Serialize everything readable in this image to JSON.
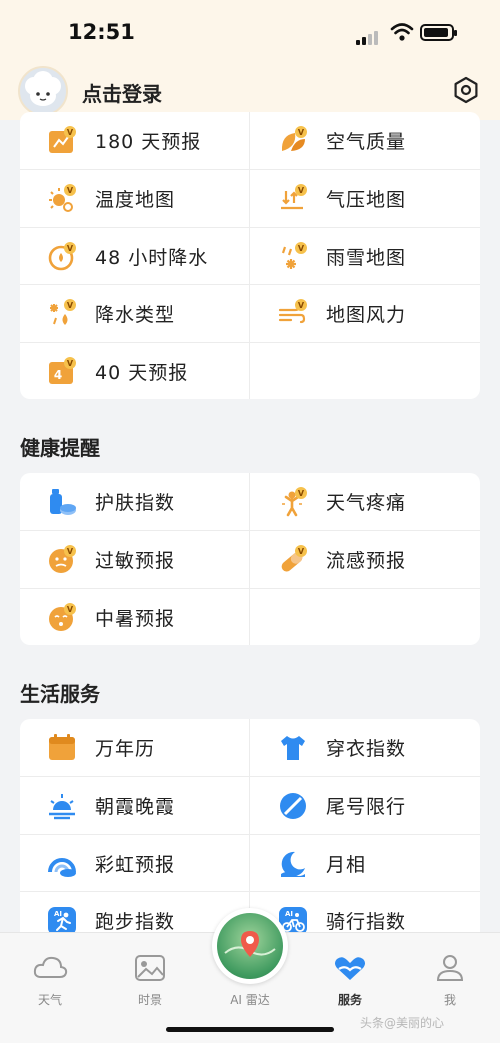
{
  "status": {
    "time": "12:51"
  },
  "header": {
    "login_label": "点击登录"
  },
  "weather_services": [
    {
      "name": "180-day-forecast",
      "label": "180 天预报",
      "icon": "calendar-180-icon"
    },
    {
      "name": "air-quality",
      "label": "空气质量",
      "icon": "leaf-icon"
    },
    {
      "name": "temperature-map",
      "label": "温度地图",
      "icon": "sun-thermometer-icon"
    },
    {
      "name": "pressure-map",
      "label": "气压地图",
      "icon": "pressure-arrows-icon"
    },
    {
      "name": "48h-precipitation",
      "label": "48 小时降水",
      "icon": "clock-rain-icon"
    },
    {
      "name": "rain-snow-map",
      "label": "雨雪地图",
      "icon": "rain-snow-icon"
    },
    {
      "name": "precipitation-type",
      "label": "降水类型",
      "icon": "drops-icon"
    },
    {
      "name": "wind-map",
      "label": "地图风力",
      "icon": "wind-icon"
    },
    {
      "name": "40-day-forecast",
      "label": "40 天预报",
      "icon": "calendar-40-icon"
    }
  ],
  "health": {
    "title": "健康提醒",
    "items": [
      {
        "name": "skin-care-index",
        "label": "护肤指数",
        "icon": "skincare-bottle-icon"
      },
      {
        "name": "weather-pain",
        "label": "天气疼痛",
        "icon": "pain-figure-icon"
      },
      {
        "name": "allergy-forecast",
        "label": "过敏预报",
        "icon": "allergy-face-icon"
      },
      {
        "name": "flu-forecast",
        "label": "流感预报",
        "icon": "pill-icon"
      },
      {
        "name": "heatstroke-forecast",
        "label": "中暑预报",
        "icon": "heatstroke-face-icon"
      }
    ]
  },
  "life": {
    "title": "生活服务",
    "items": [
      {
        "name": "calendar",
        "label": "万年历",
        "icon": "calendar-icon"
      },
      {
        "name": "dressing-index",
        "label": "穿衣指数",
        "icon": "tshirt-icon"
      },
      {
        "name": "sunrise-glow",
        "label": "朝霞晚霞",
        "icon": "sunrise-icon"
      },
      {
        "name": "plate-restriction",
        "label": "尾号限行",
        "icon": "no-entry-icon"
      },
      {
        "name": "rainbow-forecast",
        "label": "彩虹预报",
        "icon": "rainbow-icon"
      },
      {
        "name": "moon-phase",
        "label": "月相",
        "icon": "moon-icon"
      },
      {
        "name": "running-index",
        "label": "跑步指数",
        "icon": "running-icon"
      },
      {
        "name": "cycling-index",
        "label": "骑行指数",
        "icon": "cycling-icon"
      }
    ]
  },
  "tabbar": [
    {
      "name": "weather",
      "label": "天气",
      "icon": "cloud-icon"
    },
    {
      "name": "scenery",
      "label": "时景",
      "icon": "image-icon"
    },
    {
      "name": "ai-radar",
      "label": "AI 雷达",
      "icon": "radar-map-icon"
    },
    {
      "name": "services",
      "label": "服务",
      "icon": "heart-hands-icon",
      "active": true
    },
    {
      "name": "me",
      "label": "我",
      "icon": "person-icon"
    }
  ],
  "watermark": "头条@美丽的心",
  "colors": {
    "accent_orange": "#F0A23A",
    "accent_blue": "#2F8BF0",
    "header_bg": "#FDF6EA"
  }
}
